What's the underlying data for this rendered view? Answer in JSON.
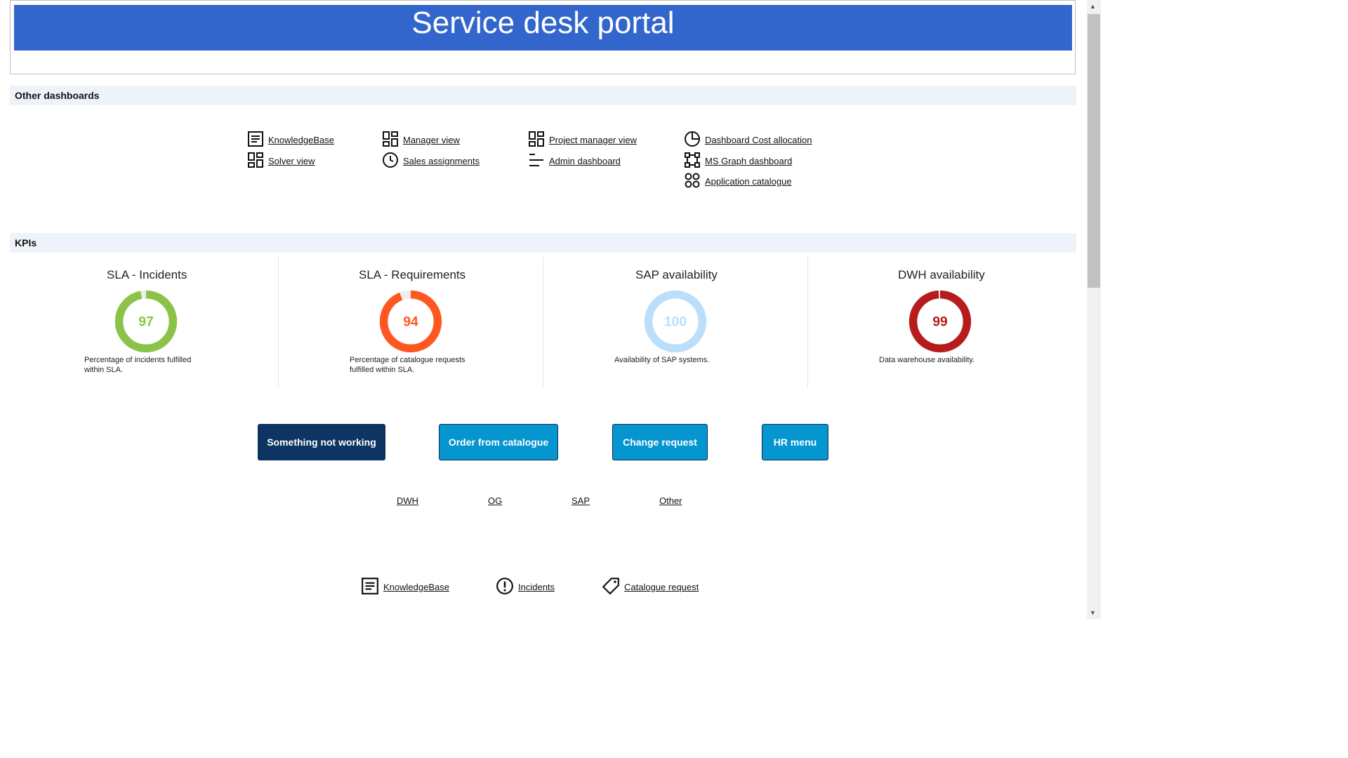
{
  "header": {
    "title": "Service desk portal"
  },
  "sections": {
    "other_dashboards": "Other dashboards",
    "kpis": "KPIs"
  },
  "dashboards": [
    {
      "label": "KnowledgeBase",
      "icon": "article-icon"
    },
    {
      "label": "Solver view",
      "icon": "dashboard-grid-icon"
    },
    {
      "label": "Manager view",
      "icon": "dashboard-grid-icon"
    },
    {
      "label": "Sales assignments",
      "icon": "clock-icon"
    },
    {
      "label": "Project manager view",
      "icon": "dashboard-grid-icon"
    },
    {
      "label": "Admin dashboard",
      "icon": "align-lines-icon"
    },
    {
      "label": "Dashboard Cost allocation",
      "icon": "pie-chart-icon"
    },
    {
      "label": "MS Graph dashboard",
      "icon": "graph-nodes-icon"
    },
    {
      "label": "Application catalogue",
      "icon": "apps-icon"
    }
  ],
  "kpis": [
    {
      "title": "SLA - Incidents",
      "value": "97",
      "percent": 97,
      "color": "#8bc34a",
      "desc": "Percentage of incidents fulfilled within SLA."
    },
    {
      "title": "SLA - Requirements",
      "value": "94",
      "percent": 94,
      "color": "#ff5722",
      "desc": "Percentage of catalogue requests fulfilled within SLA."
    },
    {
      "title": "SAP availability",
      "value": "100",
      "percent": 100,
      "color": "#bbdefb",
      "desc": "Availability of SAP systems."
    },
    {
      "title": "DWH availability",
      "value": "99",
      "percent": 99,
      "color": "#b71c1c",
      "desc": "Data warehouse availability."
    }
  ],
  "actions": [
    {
      "label": "Something not working",
      "color": "#0d3463"
    },
    {
      "label": "Order from catalogue",
      "color": "#0696cf"
    },
    {
      "label": "Change request",
      "color": "#0696cf"
    },
    {
      "label": "HR menu",
      "color": "#0696cf"
    }
  ],
  "sub_links": [
    "DWH",
    "OG",
    "SAP",
    "Other"
  ],
  "bottom_links": [
    {
      "label": "KnowledgeBase",
      "icon": "article-icon"
    },
    {
      "label": "Incidents",
      "icon": "alert-circle-icon"
    },
    {
      "label": "Catalogue request",
      "icon": "tag-icon"
    }
  ],
  "colors": {
    "header": "#3366cc",
    "section_bg": "#eef3fa",
    "gauge_track": "#eeeeee"
  }
}
